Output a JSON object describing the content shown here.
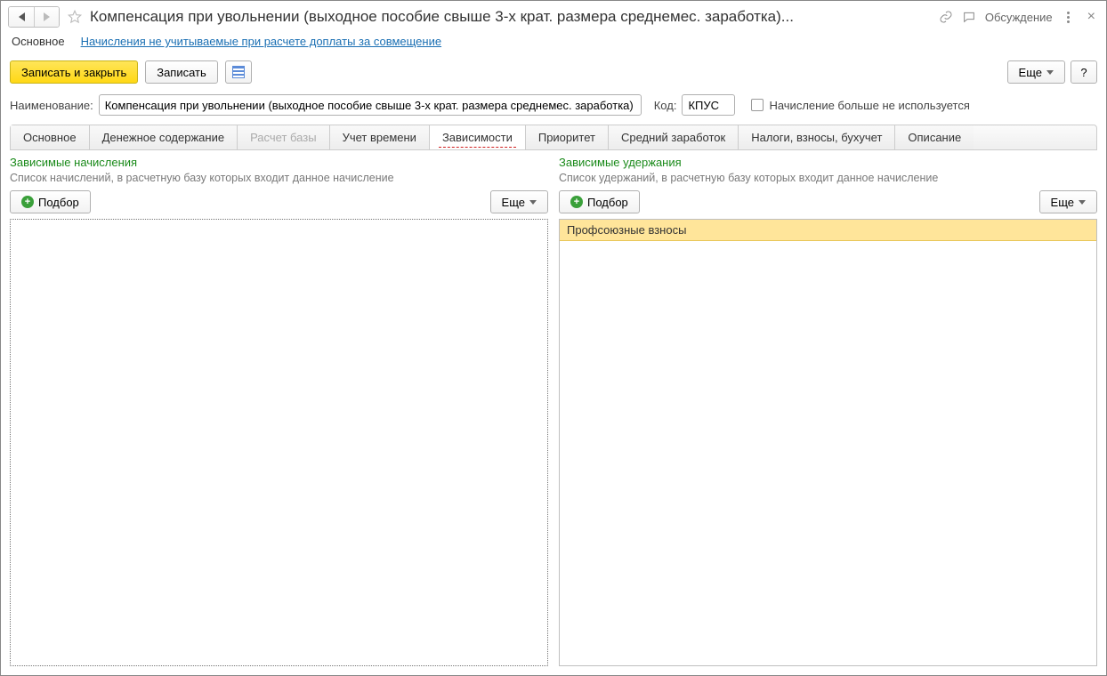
{
  "header": {
    "title": "Компенсация при увольнении (выходное пособие свыше 3-х крат. размера среднемес. заработка)...",
    "discussion_label": "Обсуждение"
  },
  "subnav": {
    "main": "Основное",
    "link": "Начисления не учитываемые при расчете доплаты за совмещение"
  },
  "toolbar": {
    "save_close": "Записать и закрыть",
    "save": "Записать",
    "more": "Еще",
    "help": "?"
  },
  "form": {
    "name_label": "Наименование:",
    "name_value": "Компенсация при увольнении (выходное пособие свыше 3-х крат. размера среднемес. заработка)",
    "code_label": "Код:",
    "code_value": "КПУС",
    "unused_label": "Начисление больше не используется"
  },
  "tabs": {
    "t0": "Основное",
    "t1": "Денежное содержание",
    "t2": "Расчет базы",
    "t3": "Учет времени",
    "t4": "Зависимости",
    "t5": "Приоритет",
    "t6": "Средний заработок",
    "t7": "Налоги, взносы, бухучет",
    "t8": "Описание"
  },
  "left_panel": {
    "title": "Зависимые начисления",
    "desc": "Список начислений, в расчетную базу которых входит данное начисление",
    "pick": "Подбор",
    "more": "Еще",
    "rows": []
  },
  "right_panel": {
    "title": "Зависимые удержания",
    "desc": "Список удержаний, в расчетную базу которых входит данное начисление",
    "pick": "Подбор",
    "more": "Еще",
    "rows": [
      "Профсоюзные взносы"
    ]
  }
}
